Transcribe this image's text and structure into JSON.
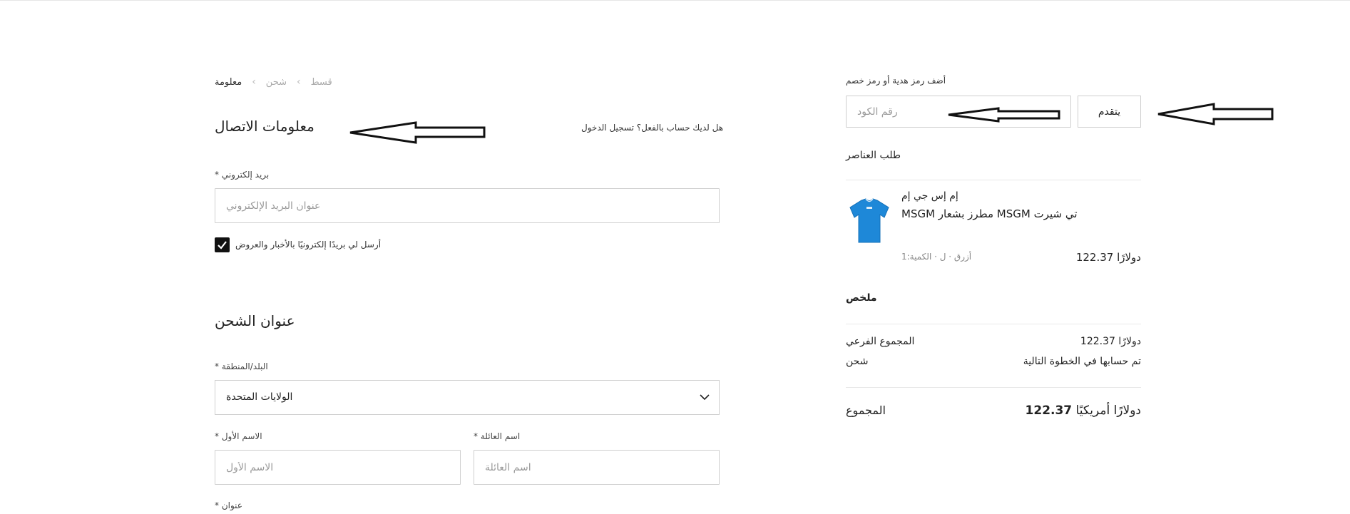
{
  "breadcrumb": {
    "steps": [
      "معلومة",
      "شحن",
      "قسط"
    ],
    "separator": "‹",
    "active_index": 0
  },
  "contact": {
    "title": "معلومات الاتصال",
    "login_prompt": "هل لديك حساب بالفعل؟ تسجيل الدخول",
    "email_label": "* بريد إلكتروني",
    "email_placeholder": "عنوان البريد الإلكتروني",
    "newsletter_label": "أرسل لي بريدًا إلكترونيًا بالأخبار والعروض",
    "newsletter_checked": true
  },
  "shipping": {
    "title": "عنوان الشحن",
    "country_label": "* البلد/المنطقة",
    "country_value": "الولايات المتحدة",
    "first_name_label": "* الاسم الأول",
    "first_name_placeholder": "الاسم الأول",
    "last_name_label": "* اسم العائلة",
    "last_name_placeholder": "اسم العائلة",
    "address_label": "* عنوان"
  },
  "promo": {
    "label": "أضف رمز هدية أو رمز خصم",
    "placeholder": "رقم الكود",
    "apply_label": "يتقدم"
  },
  "order": {
    "title": "طلب العناصر",
    "items": [
      {
        "brand": "إم إس جي إم",
        "name": "MSGM مطرز بشعار MSGM تي شيرت",
        "meta": "أزرق · ل · الكمية:1",
        "price": "دولارًا 122.37",
        "color": "#1e88d8"
      }
    ]
  },
  "summary": {
    "title": "ملخص",
    "subtotal_label": "المجموع الفرعي",
    "subtotal_value": "دولارًا 122.37",
    "shipping_label": "شحن",
    "shipping_value": "تم حسابها في الخطوة التالية",
    "total_label": "المجموع",
    "total_amount": "122.37",
    "total_currency": "دولارًا أمريكيًا"
  }
}
